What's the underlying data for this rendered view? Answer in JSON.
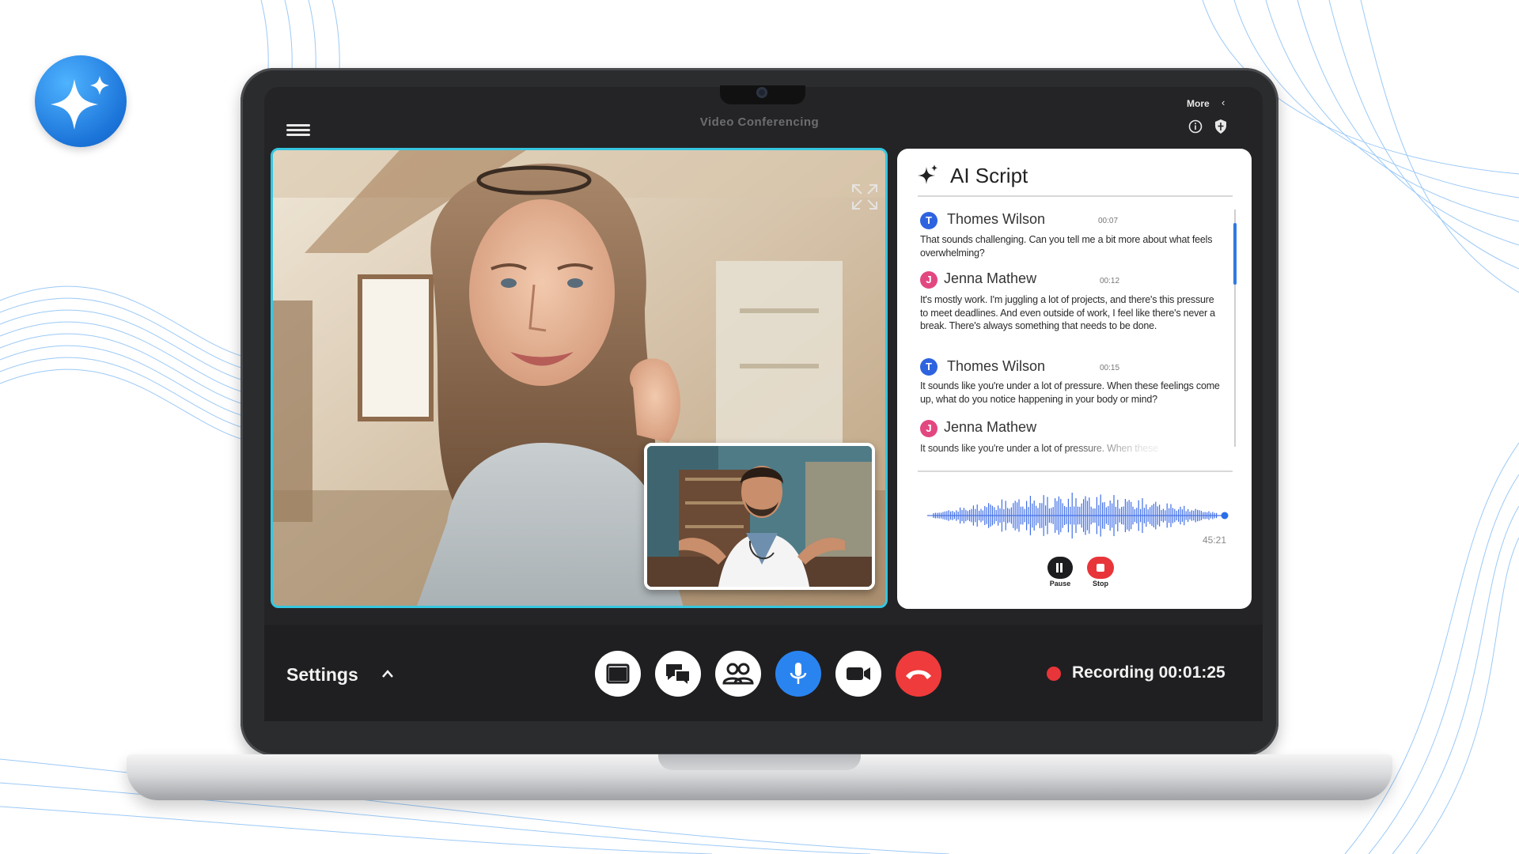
{
  "app": {
    "title": "Video Conferencing",
    "more_label": "More"
  },
  "ai_script": {
    "title": "AI Script",
    "messages": [
      {
        "initial": "T",
        "name": "Thomes Wilson",
        "time": "00:07",
        "text": "That sounds challenging. Can you tell me a bit more about what feels overwhelming?"
      },
      {
        "initial": "J",
        "name": "Jenna Mathew",
        "time": "00:12",
        "text": "It's mostly work. I'm juggling a lot of projects, and there's this pressure to meet deadlines. And even outside of work, I feel like there's never a break. There's always something that needs to be done."
      },
      {
        "initial": "T",
        "name": "Thomes Wilson",
        "time": "00:15",
        "text": "It sounds like you're under a lot of pressure. When these feelings come up, what do you notice happening in your body or mind?"
      },
      {
        "initial": "J",
        "name": "Jenna Mathew",
        "time": "",
        "text": "It sounds like you're under a lot of pressure. When these"
      }
    ],
    "audio_time": "45:21",
    "pause_label": "Pause",
    "stop_label": "Stop"
  },
  "bottom": {
    "settings_label": "Settings",
    "recording_label": "Recording 00:01:25"
  },
  "colors": {
    "accent_cyan": "#36c6e0",
    "mic_blue": "#2a84f0",
    "end_red": "#ef3b3b",
    "record_red": "#e8353a",
    "avatar_blue": "#2e63e0",
    "avatar_pink": "#e24780"
  },
  "icons": {
    "logo": "sparkle-icon",
    "menu": "hamburger-menu-icon",
    "info": "info-icon",
    "shield": "shield-icon",
    "expand": "expand-icon",
    "controls": [
      "screen-share-icon",
      "chat-icon",
      "participants-icon",
      "microphone-icon",
      "camera-icon",
      "end-call-icon"
    ]
  }
}
